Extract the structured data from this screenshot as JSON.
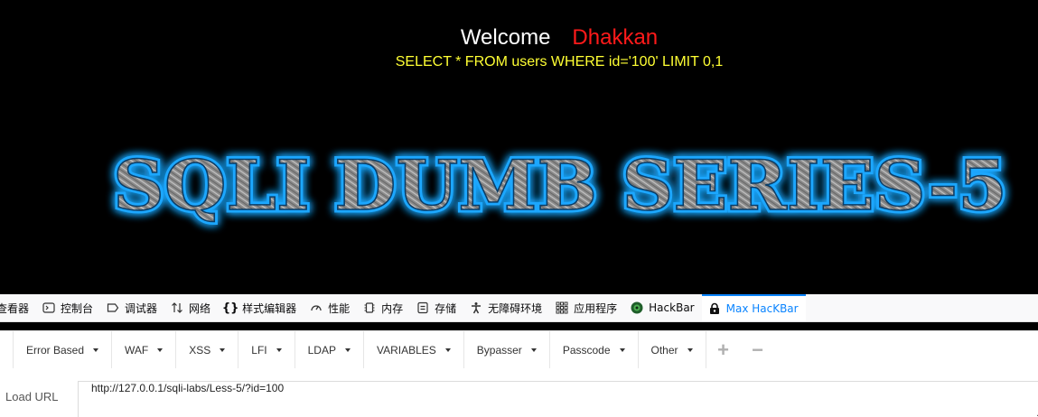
{
  "page": {
    "welcome": "Welcome",
    "username": "Dhakkan",
    "query": "SELECT * FROM users WHERE id='100' LIMIT 0,1",
    "banner_text": "SQLI DUMB SERIES-5"
  },
  "devtools": {
    "tabs": [
      {
        "label": "查看器",
        "icon": "inspector-icon"
      },
      {
        "label": "控制台",
        "icon": "console-icon"
      },
      {
        "label": "调试器",
        "icon": "debugger-icon"
      },
      {
        "label": "网络",
        "icon": "network-icon"
      },
      {
        "label": "样式编辑器",
        "icon": "style-editor-icon"
      },
      {
        "label": "性能",
        "icon": "performance-icon"
      },
      {
        "label": "内存",
        "icon": "memory-icon"
      },
      {
        "label": "存储",
        "icon": "storage-icon"
      },
      {
        "label": "无障碍环境",
        "icon": "accessibility-icon"
      },
      {
        "label": "应用程序",
        "icon": "application-icon"
      },
      {
        "label": "HackBar",
        "icon": "hackbar-icon"
      },
      {
        "label": "Max HacKBar",
        "icon": "max-hackbar-icon",
        "active": true
      }
    ],
    "active_color": "#0a84ff"
  },
  "hackbar": {
    "menus": [
      "Error Based",
      "WAF",
      "XSS",
      "LFI",
      "LDAP",
      "VARIABLES",
      "Bypasser",
      "Passcode",
      "Other"
    ],
    "add_symbol": "+",
    "remove_symbol": "−",
    "load_url_label": "Load URL",
    "url_value": "http://127.0.0.1/sqli-labs/Less-5/?id=100"
  },
  "colors": {
    "welcome": "#ffffff",
    "username": "#ff1a1a",
    "query": "#ffff33",
    "banner_glow": "#1ea7ff"
  }
}
